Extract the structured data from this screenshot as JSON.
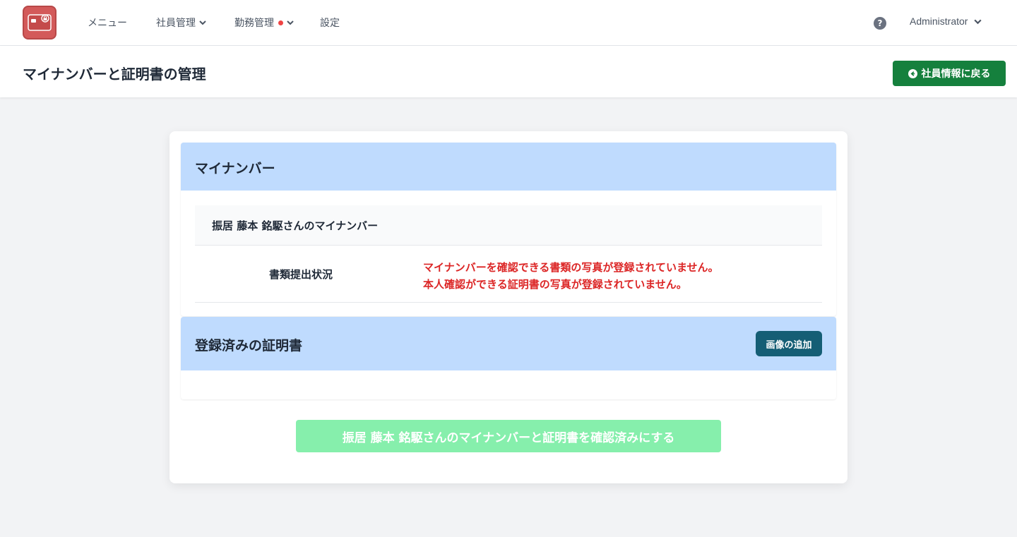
{
  "nav": {
    "logo_icon": "id-card-lock-icon",
    "items": [
      {
        "label": "メニュー"
      },
      {
        "label": "社員管理"
      },
      {
        "label": "勤務管理",
        "badge": "red-dot"
      },
      {
        "label": "設定"
      }
    ],
    "help_icon": "question-circle-icon",
    "help_glyph": "?",
    "user": "Administrator"
  },
  "header": {
    "title": "マイナンバーと証明書の管理",
    "back_button": "社員情報に戻る"
  },
  "mynumber_section": {
    "title": "マイナンバー",
    "owner_label": "振居 藤本 銘駆さんのマイナンバー",
    "status_label": "書類提出状況",
    "status_lines": [
      "マイナンバーを確認できる書類の写真が登録されていません。",
      "本人確認ができる証明書の写真が登録されていません。"
    ]
  },
  "certificates_section": {
    "title": "登録済みの証明書",
    "add_button": "画像の追加"
  },
  "confirm_button": "振居 藤本 銘駆さんのマイナンバーと証明書を確認済みにする",
  "colors": {
    "primary_green": "#15803d",
    "section_header_blue": "#bfdbfe",
    "teal_button": "#155e75",
    "error_red": "#dc2626",
    "disabled_green": "#86efac",
    "logo_red": "#d35a5a"
  }
}
